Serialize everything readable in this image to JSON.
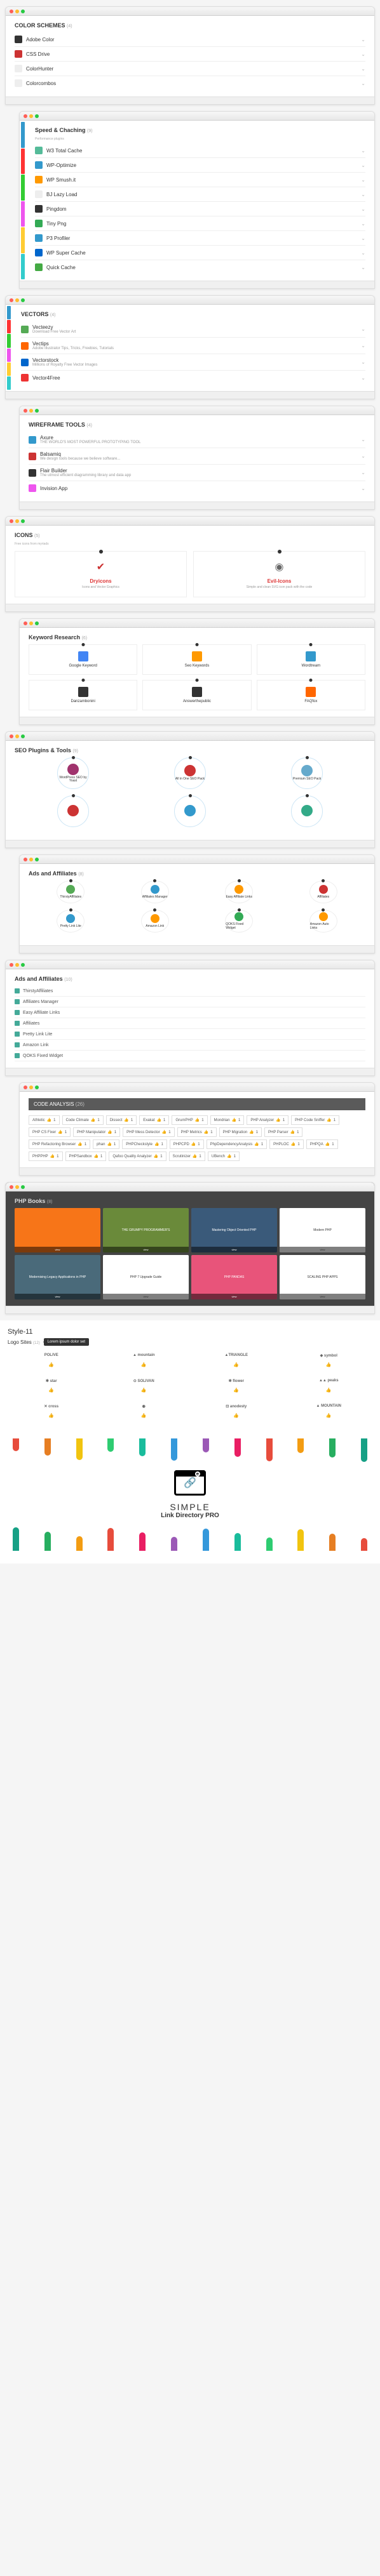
{
  "colorSchemes": {
    "title": "COLOR SCHEMES",
    "count": "(4)",
    "items": [
      {
        "t": "Adobe Color",
        "c": "#333"
      },
      {
        "t": "CSS Drive",
        "c": "#c33"
      },
      {
        "t": "ColorHunter",
        "c": "#eee"
      },
      {
        "t": "Colorcombos",
        "c": "#eee"
      }
    ]
  },
  "speed": {
    "title": "Speed & Chaching",
    "count": "(9)",
    "sub": "Performance plugins",
    "items": [
      {
        "t": "W3 Total Cache",
        "c": "#5b9"
      },
      {
        "t": "WP-Optimize",
        "c": "#39c"
      },
      {
        "t": "WP Smush.it",
        "c": "#f90"
      },
      {
        "t": "BJ Lazy Load",
        "c": "#eee"
      },
      {
        "t": "Pingdom",
        "c": "#333"
      },
      {
        "t": "Tiny Png",
        "c": "#3a5"
      },
      {
        "t": "P3 Profiler",
        "c": "#39c"
      },
      {
        "t": "WP Super Cache",
        "c": "#06c"
      },
      {
        "t": "Quick Cache",
        "c": "#4a4"
      }
    ],
    "sidebar": [
      "#39c",
      "#f33",
      "#3c3",
      "#e5e",
      "#fc3",
      "#3cc"
    ]
  },
  "vectors": {
    "title": "VECTORS",
    "count": "(4)",
    "items": [
      {
        "t": "Vecteezy",
        "d": "Download Free Vector Art",
        "c": "#5a5"
      },
      {
        "t": "Vectips",
        "d": "Adobe Illustrator Tips, Tricks, Freebies, Tutorials",
        "c": "#f60"
      },
      {
        "t": "Vectorstock",
        "d": "Millions of Royalty Free Vector Images",
        "c": "#06c"
      },
      {
        "t": "Vector4Free",
        "d": "",
        "c": "#e33"
      }
    ],
    "sidebar": [
      "#39c",
      "#f33",
      "#3c3",
      "#e5e",
      "#fc3",
      "#3cc"
    ]
  },
  "wireframe": {
    "title": "WIREFRAME TOOLS",
    "count": "(4)",
    "items": [
      {
        "t": "Axure",
        "d": "THE WORLD'S MOST POWERFUL PROTOTYPING TOOL",
        "c": "#39c"
      },
      {
        "t": "Balsamiq",
        "d": "We design tools because we believe software...",
        "c": "#c33"
      },
      {
        "t": "Flair Builder",
        "d": "The utmost efficient diagramming library and data app",
        "c": "#333"
      },
      {
        "t": "Invision App",
        "d": "",
        "c": "#e5e"
      }
    ]
  },
  "icons": {
    "title": "ICONS",
    "count": "(5)",
    "sub": "Free icons from myriads",
    "items": [
      {
        "t": "Dryicons",
        "d": "Icons and Vector Graphics",
        "c": "#c33",
        "svg": "check"
      },
      {
        "t": "Evil-Icons",
        "d": "Simple and clean SVG icon pack with the code",
        "c": "#666",
        "svg": "evil"
      }
    ]
  },
  "keyword": {
    "title": "Keyword Research",
    "count": "(6)",
    "items": [
      {
        "t": "Google Keyword",
        "c": "#4285f4"
      },
      {
        "t": "Seo Keywords",
        "c": "#f90"
      },
      {
        "t": "Wordtream",
        "c": "#39c"
      },
      {
        "t": "Danzambonini",
        "c": "#333"
      },
      {
        "t": "Answerthepublic",
        "c": "#333"
      },
      {
        "t": "FAQfox",
        "c": "#f60"
      }
    ]
  },
  "seo": {
    "title": "SEO Plugins & Tools",
    "count": "(9)",
    "r1": [
      {
        "t": "WordPress SEO by Yoast",
        "c": "#a0336d"
      },
      {
        "t": "All in One SEO Pack",
        "c": "#c33"
      },
      {
        "t": "Premium SEO Pack",
        "c": "#6ac"
      }
    ],
    "r2": [
      {
        "c": "#c33"
      },
      {
        "c": "#39c"
      },
      {
        "c": "#3a8"
      }
    ]
  },
  "ads": {
    "title": "Ads and Affiliates",
    "count": "(8)",
    "r1": [
      {
        "t": "ThirstyAffiliates",
        "c": "#5a5"
      },
      {
        "t": "Affiliates Manager",
        "c": "#39c"
      },
      {
        "t": "Easy Affiliate Links",
        "c": "#f90"
      },
      {
        "t": "Affiliates",
        "c": "#c33"
      }
    ],
    "r2": [
      {
        "t": "Pretty Link Lite",
        "c": "#39c"
      },
      {
        "t": "Amazon Link",
        "c": "#f90"
      },
      {
        "t": "QOKS Fixed Widget",
        "c": "#3a5"
      },
      {
        "t": "Amazon Auto Links",
        "c": "#f90"
      }
    ]
  },
  "ads2": {
    "title": "Ads and Affiliates",
    "count": "(10)",
    "items": [
      "ThirstyAffiliates",
      "Affiliates Manager",
      "Easy Affiliate Links",
      "Affiliates",
      "Pretty Link Lite",
      "Amazon Link",
      "QOKS Fixed Widget"
    ]
  },
  "code": {
    "title": "CODE ANALYSIS",
    "count": "(26)",
    "tags": [
      "Athletic",
      "Code Climate",
      "Dissect",
      "Exakat",
      "GrumPHP",
      "Mondrian",
      "PHP Analyzer",
      "PHP Code Sniffer",
      "PHP CS Fixer",
      "PHP Manipulator",
      "PHP Mess Detector",
      "PHP Metrics",
      "PHP Migration",
      "PHP Parser",
      "PHP Refactoring Browser",
      "phan",
      "PHPCheckstyle",
      "PHPCPD",
      "PhpDependencyAnalysis",
      "PHPLOC",
      "PHPQA",
      "PHPPHP",
      "PHPSandbox",
      "Qafoo Quality Analyzer",
      "Scrutinizer",
      "UBench"
    ]
  },
  "books": {
    "title": "PHP Books",
    "count": "(8)",
    "items": [
      {
        "t": "",
        "c": "#f77518"
      },
      {
        "t": "THE GRUMPY PROGRAMMER'S",
        "c": "#6a8a3a"
      },
      {
        "t": "Mastering Object Oriented PHP",
        "c": "#3a5a7a"
      },
      {
        "t": "Modern PHP",
        "c": "#fff",
        "tc": "#333"
      },
      {
        "t": "Modernising Legacy Applications in PHP",
        "c": "#4a6a7a"
      },
      {
        "t": "PHP 7 Upgrade Guide",
        "c": "#fff",
        "tc": "#333"
      },
      {
        "t": "PHP PANDAS",
        "c": "#e8547a"
      },
      {
        "t": "SCALING PHP APPS",
        "c": "#fff",
        "tc": "#333"
      }
    ]
  },
  "style11": {
    "title": "Style-11",
    "sub": "Logo Sites",
    "count": "(12)",
    "tip": "Lorem ipsum dolor set",
    "items": [
      "POLIVE",
      "▲ mountain",
      "▲TRIANGLE",
      "◆ symbol",
      "✱ star",
      "⊙ SOLIVAN",
      "❋ flower",
      "▲▲ peaks",
      "✕ cross",
      "◉",
      "⊡ anodesty",
      "▲ MOUNTAIN"
    ]
  },
  "footer": {
    "l1": "SIMPLE",
    "l2": "Link Directory PRO",
    "drips": [
      "#e74c3c",
      "#e67e22",
      "#f1c40f",
      "#2ecc71",
      "#1abc9c",
      "#3498db",
      "#9b59b6",
      "#e91e63",
      "#e74c3c",
      "#f39c12",
      "#27ae60",
      "#16a085"
    ]
  },
  "thumb": "👍"
}
